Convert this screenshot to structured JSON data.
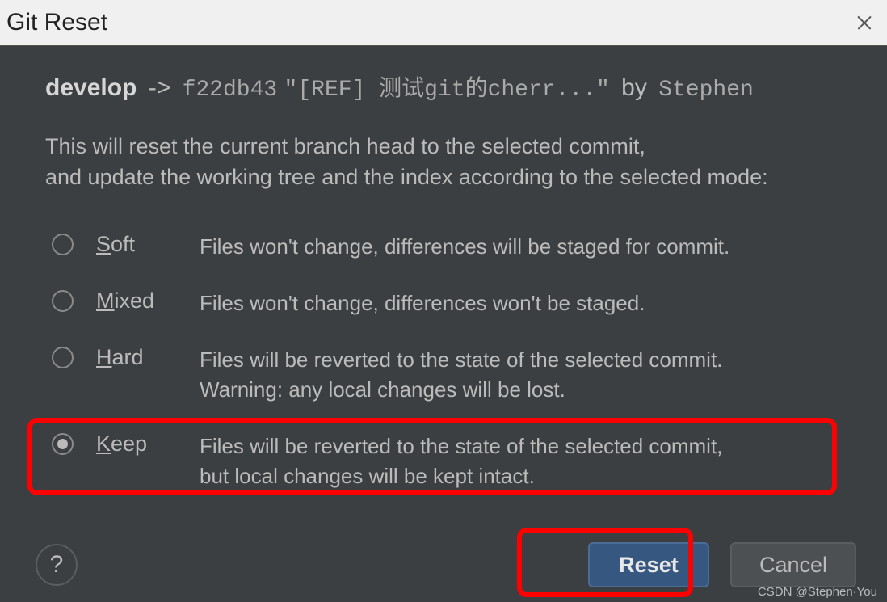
{
  "title": "Git Reset",
  "commit": {
    "branch": "develop",
    "arrow": "->",
    "hash": "f22db43",
    "message": "\"[REF] 测试git的cherr...\"",
    "by": "by",
    "author": "Stephen"
  },
  "description_line1": "This will reset the current branch head to the selected commit,",
  "description_line2": "and update the working tree and the index according to the selected mode:",
  "options": {
    "soft": {
      "mnemonic": "S",
      "rest": "oft",
      "desc": "Files won't change, differences will be staged for commit."
    },
    "mixed": {
      "mnemonic": "M",
      "rest": "ixed",
      "desc": "Files won't change, differences won't be staged."
    },
    "hard": {
      "mnemonic": "H",
      "rest": "ard",
      "desc": "Files will be reverted to the state of the selected commit.\nWarning: any local changes will be lost."
    },
    "keep": {
      "mnemonic": "K",
      "rest": "eep",
      "desc": "Files will be reverted to the state of the selected commit,\nbut local changes will be kept intact."
    }
  },
  "selected": "keep",
  "buttons": {
    "help": "?",
    "reset": "Reset",
    "cancel": "Cancel"
  },
  "watermark": "CSDN @Stephen·You"
}
